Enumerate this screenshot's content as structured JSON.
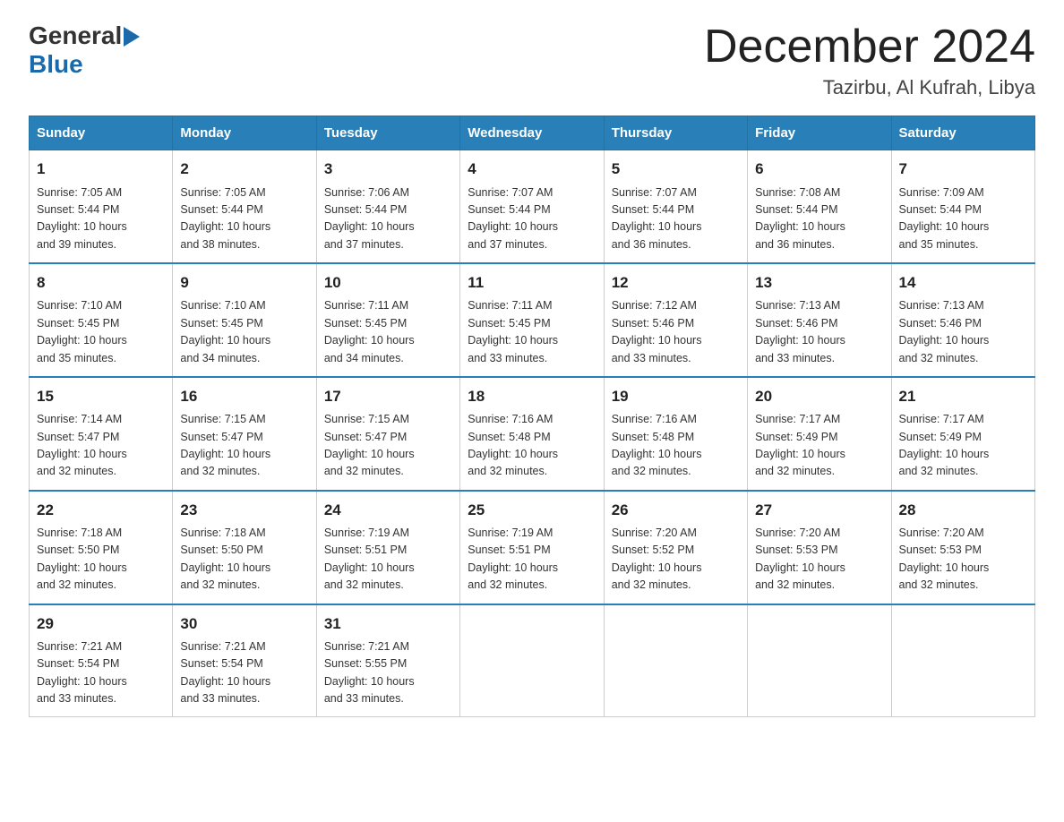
{
  "logo": {
    "general": "General",
    "blue": "Blue"
  },
  "title": "December 2024",
  "subtitle": "Tazirbu, Al Kufrah, Libya",
  "days": [
    "Sunday",
    "Monday",
    "Tuesday",
    "Wednesday",
    "Thursday",
    "Friday",
    "Saturday"
  ],
  "weeks": [
    [
      {
        "num": "1",
        "sunrise": "7:05 AM",
        "sunset": "5:44 PM",
        "daylight": "10 hours and 39 minutes."
      },
      {
        "num": "2",
        "sunrise": "7:05 AM",
        "sunset": "5:44 PM",
        "daylight": "10 hours and 38 minutes."
      },
      {
        "num": "3",
        "sunrise": "7:06 AM",
        "sunset": "5:44 PM",
        "daylight": "10 hours and 37 minutes."
      },
      {
        "num": "4",
        "sunrise": "7:07 AM",
        "sunset": "5:44 PM",
        "daylight": "10 hours and 37 minutes."
      },
      {
        "num": "5",
        "sunrise": "7:07 AM",
        "sunset": "5:44 PM",
        "daylight": "10 hours and 36 minutes."
      },
      {
        "num": "6",
        "sunrise": "7:08 AM",
        "sunset": "5:44 PM",
        "daylight": "10 hours and 36 minutes."
      },
      {
        "num": "7",
        "sunrise": "7:09 AM",
        "sunset": "5:44 PM",
        "daylight": "10 hours and 35 minutes."
      }
    ],
    [
      {
        "num": "8",
        "sunrise": "7:10 AM",
        "sunset": "5:45 PM",
        "daylight": "10 hours and 35 minutes."
      },
      {
        "num": "9",
        "sunrise": "7:10 AM",
        "sunset": "5:45 PM",
        "daylight": "10 hours and 34 minutes."
      },
      {
        "num": "10",
        "sunrise": "7:11 AM",
        "sunset": "5:45 PM",
        "daylight": "10 hours and 34 minutes."
      },
      {
        "num": "11",
        "sunrise": "7:11 AM",
        "sunset": "5:45 PM",
        "daylight": "10 hours and 33 minutes."
      },
      {
        "num": "12",
        "sunrise": "7:12 AM",
        "sunset": "5:46 PM",
        "daylight": "10 hours and 33 minutes."
      },
      {
        "num": "13",
        "sunrise": "7:13 AM",
        "sunset": "5:46 PM",
        "daylight": "10 hours and 33 minutes."
      },
      {
        "num": "14",
        "sunrise": "7:13 AM",
        "sunset": "5:46 PM",
        "daylight": "10 hours and 32 minutes."
      }
    ],
    [
      {
        "num": "15",
        "sunrise": "7:14 AM",
        "sunset": "5:47 PM",
        "daylight": "10 hours and 32 minutes."
      },
      {
        "num": "16",
        "sunrise": "7:15 AM",
        "sunset": "5:47 PM",
        "daylight": "10 hours and 32 minutes."
      },
      {
        "num": "17",
        "sunrise": "7:15 AM",
        "sunset": "5:47 PM",
        "daylight": "10 hours and 32 minutes."
      },
      {
        "num": "18",
        "sunrise": "7:16 AM",
        "sunset": "5:48 PM",
        "daylight": "10 hours and 32 minutes."
      },
      {
        "num": "19",
        "sunrise": "7:16 AM",
        "sunset": "5:48 PM",
        "daylight": "10 hours and 32 minutes."
      },
      {
        "num": "20",
        "sunrise": "7:17 AM",
        "sunset": "5:49 PM",
        "daylight": "10 hours and 32 minutes."
      },
      {
        "num": "21",
        "sunrise": "7:17 AM",
        "sunset": "5:49 PM",
        "daylight": "10 hours and 32 minutes."
      }
    ],
    [
      {
        "num": "22",
        "sunrise": "7:18 AM",
        "sunset": "5:50 PM",
        "daylight": "10 hours and 32 minutes."
      },
      {
        "num": "23",
        "sunrise": "7:18 AM",
        "sunset": "5:50 PM",
        "daylight": "10 hours and 32 minutes."
      },
      {
        "num": "24",
        "sunrise": "7:19 AM",
        "sunset": "5:51 PM",
        "daylight": "10 hours and 32 minutes."
      },
      {
        "num": "25",
        "sunrise": "7:19 AM",
        "sunset": "5:51 PM",
        "daylight": "10 hours and 32 minutes."
      },
      {
        "num": "26",
        "sunrise": "7:20 AM",
        "sunset": "5:52 PM",
        "daylight": "10 hours and 32 minutes."
      },
      {
        "num": "27",
        "sunrise": "7:20 AM",
        "sunset": "5:53 PM",
        "daylight": "10 hours and 32 minutes."
      },
      {
        "num": "28",
        "sunrise": "7:20 AM",
        "sunset": "5:53 PM",
        "daylight": "10 hours and 32 minutes."
      }
    ],
    [
      {
        "num": "29",
        "sunrise": "7:21 AM",
        "sunset": "5:54 PM",
        "daylight": "10 hours and 33 minutes."
      },
      {
        "num": "30",
        "sunrise": "7:21 AM",
        "sunset": "5:54 PM",
        "daylight": "10 hours and 33 minutes."
      },
      {
        "num": "31",
        "sunrise": "7:21 AM",
        "sunset": "5:55 PM",
        "daylight": "10 hours and 33 minutes."
      },
      null,
      null,
      null,
      null
    ]
  ],
  "labels": {
    "sunrise": "Sunrise:",
    "sunset": "Sunset:",
    "daylight": "Daylight:"
  }
}
